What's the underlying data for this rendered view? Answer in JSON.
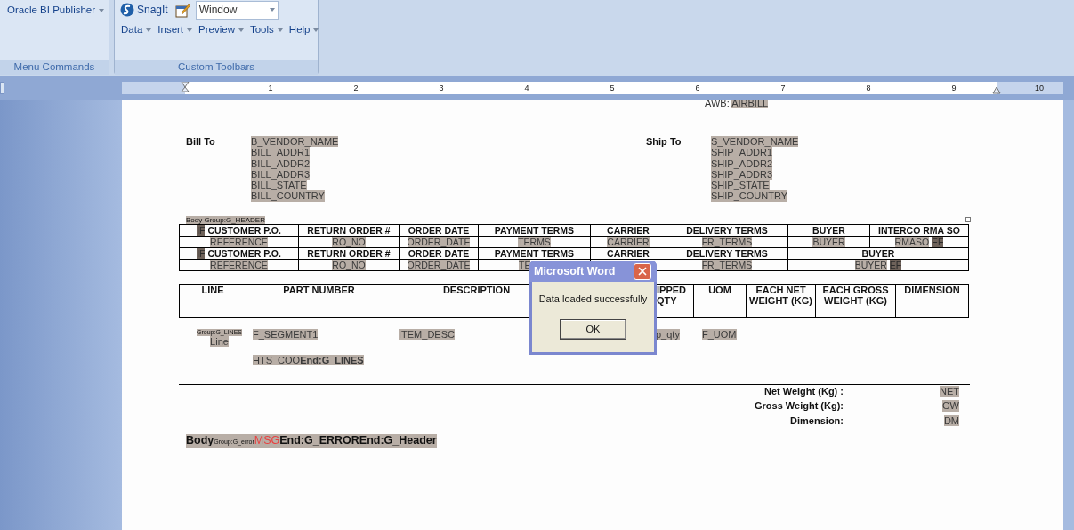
{
  "ribbon": {
    "groups": [
      {
        "title": "Menu Commands",
        "button": "Oracle BI Publisher"
      },
      {
        "title": "Custom Toolbars",
        "snagit": "SnagIt",
        "window_select": "Window",
        "menus": [
          "Data",
          "Insert",
          "Preview",
          "Tools",
          "Help"
        ]
      }
    ]
  },
  "ruler": {
    "numbers": [
      "1",
      "2",
      "3",
      "4",
      "5",
      "6",
      "7",
      "8",
      "9",
      "10"
    ]
  },
  "document": {
    "awb": {
      "label": "AWB:",
      "field": "AIRBILL"
    },
    "bill_to": {
      "label": "Bill To",
      "fields": [
        "B_VENDOR_NAME",
        "BILL_ADDR1",
        "BILL_ADDR2",
        "BILL_ADDR3",
        "BILL_STATE",
        "BILL_COUNTRY"
      ]
    },
    "ship_to": {
      "label": "Ship To",
      "fields": [
        "S_VENDOR_NAME",
        "SHIP_ADDR1",
        "SHIP_ADDR2",
        "SHIP_ADDR3",
        "SHIP_STATE",
        "SHIP_COUNTRY"
      ]
    },
    "header_group": {
      "body": "Body",
      "group": "Group:G_HEADER"
    },
    "header_table": {
      "rows": [
        {
          "cells": [
            {
              "kind": "label",
              "text": "CUSTOMER P.O.",
              "prefix": "IF"
            },
            {
              "kind": "label",
              "text": "RETURN ORDER #"
            },
            {
              "kind": "label",
              "text": "ORDER DATE"
            },
            {
              "kind": "label",
              "text": "PAYMENT TERMS"
            },
            {
              "kind": "label",
              "text": "CARRIER"
            },
            {
              "kind": "label",
              "text": "DELIVERY TERMS"
            },
            {
              "kind": "label",
              "text": "BUYER"
            },
            {
              "kind": "label",
              "text": "INTERCO RMA SO"
            }
          ]
        },
        {
          "cells": [
            {
              "kind": "field",
              "text": "REFERENCE"
            },
            {
              "kind": "field",
              "text": "RO_NO"
            },
            {
              "kind": "field",
              "text": "ORDER_DATE"
            },
            {
              "kind": "field",
              "text": "TERMS"
            },
            {
              "kind": "field",
              "text": "CARRIER"
            },
            {
              "kind": "field",
              "text": "FR_TERMS"
            },
            {
              "kind": "field",
              "text": "BUYER"
            },
            {
              "kind": "field",
              "text": "RMASO",
              "suffix": "EF"
            }
          ]
        },
        {
          "cells": [
            {
              "kind": "label",
              "text": "CUSTOMER P.O.",
              "prefix": "IF"
            },
            {
              "kind": "label",
              "text": "RETURN ORDER #"
            },
            {
              "kind": "label",
              "text": "ORDER DATE"
            },
            {
              "kind": "label",
              "text": "PAYMENT TERMS"
            },
            {
              "kind": "label",
              "text": "CARRIER"
            },
            {
              "kind": "label",
              "text": "DELIVERY TERMS"
            },
            {
              "kind": "label",
              "text": "BUYER",
              "colspan": 2
            }
          ]
        },
        {
          "cells": [
            {
              "kind": "field",
              "text": "REFERENCE"
            },
            {
              "kind": "field",
              "text": "RO_NO"
            },
            {
              "kind": "field",
              "text": "ORDER_DATE"
            },
            {
              "kind": "field-cut",
              "text": "TE"
            },
            {
              "kind": "covered"
            },
            {
              "kind": "field",
              "text": "FR_TERMS"
            },
            {
              "kind": "field",
              "text": "BUYER",
              "suffix": "EF",
              "colspan": 2
            }
          ]
        }
      ]
    },
    "lines_table": {
      "columns": [
        {
          "kind": "label",
          "text": "LINE"
        },
        {
          "kind": "label",
          "text": "PART NUMBER"
        },
        {
          "kind": "label",
          "text": "DESCRIPTION"
        },
        {
          "kind": "label-cut",
          "text": "IPPED QTY"
        },
        {
          "kind": "label",
          "text": "UOM"
        },
        {
          "kind": "label",
          "text": "EACH NET WEIGHT (KG)"
        },
        {
          "kind": "label",
          "text": "EACH GROSS WEIGHT (KG)"
        },
        {
          "kind": "label",
          "text": "DIMENSION"
        }
      ]
    },
    "lines_group": {
      "group": "Group:G_LINES",
      "line": "Line",
      "segment": "F_SEGMENT1",
      "description": "ITEM_DESC",
      "qty": "p_qty",
      "uom": "F_UOM",
      "hts": "HTS_COO**End:G_LINES**"
    },
    "totals": [
      {
        "label": "Net Weight (Kg) :",
        "value": "NET"
      },
      {
        "label": "Gross Weight (Kg):",
        "value": "GW"
      },
      {
        "label": "Dimension:",
        "value": "DM"
      }
    ],
    "footer_tags": [
      {
        "kind": "body",
        "text": "Body"
      },
      {
        "kind": "tag",
        "text": "Group:G_error"
      },
      {
        "kind": "error",
        "text": "MSG"
      },
      {
        "kind": "bold",
        "text": "End:G_ERROREnd:G_Header"
      }
    ]
  },
  "dialog": {
    "title": "Microsoft Word",
    "message": "Data loaded successfully",
    "button": "OK"
  }
}
